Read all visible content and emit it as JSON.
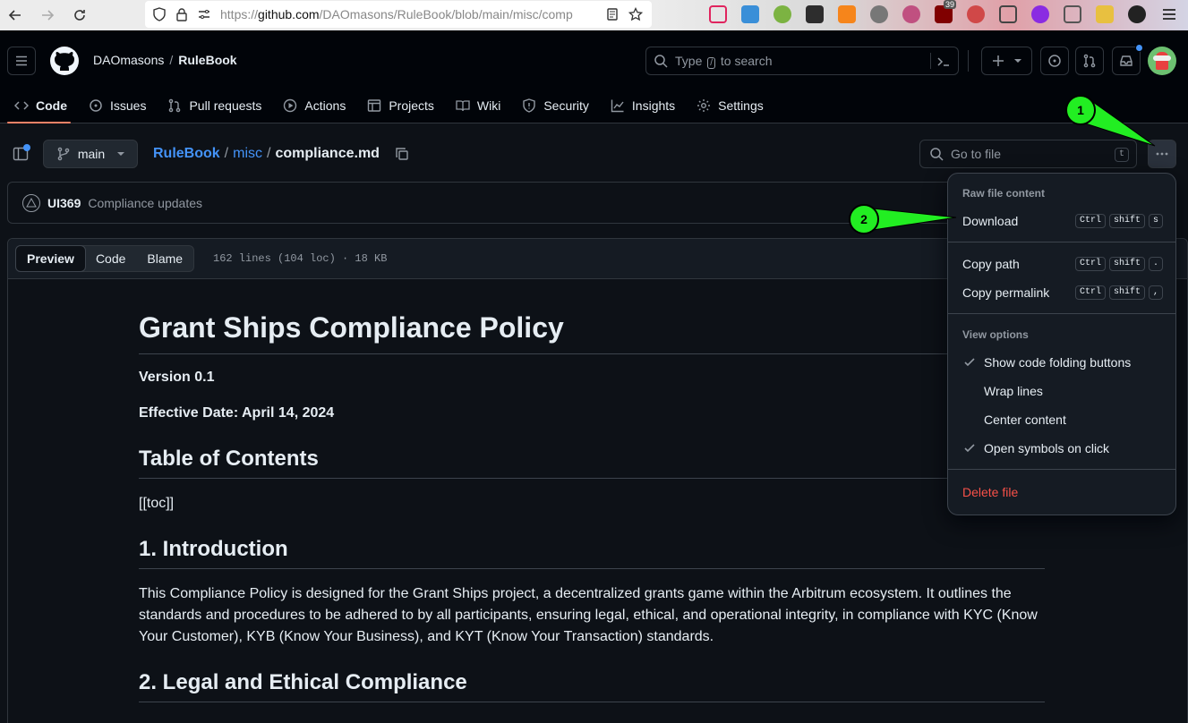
{
  "browser": {
    "url_domain": "github.com",
    "url_path": "/DAOmasons/RuleBook/blob/main/misc/comp",
    "url_prefix": "https://",
    "badge_count": "39"
  },
  "header": {
    "owner": "DAOmasons",
    "separator": "/",
    "repo": "RuleBook",
    "search_prefix": "Type",
    "search_key": "/",
    "search_suffix": "to search"
  },
  "tabs": [
    {
      "label": "Code"
    },
    {
      "label": "Issues"
    },
    {
      "label": "Pull requests"
    },
    {
      "label": "Actions"
    },
    {
      "label": "Projects"
    },
    {
      "label": "Wiki"
    },
    {
      "label": "Security"
    },
    {
      "label": "Insights"
    },
    {
      "label": "Settings"
    }
  ],
  "file_header": {
    "branch": "main",
    "path_repo": "RuleBook",
    "path_dir": "misc",
    "path_file": "compliance.md",
    "path_sep": "/",
    "go_to_file": "Go to file",
    "go_to_file_key": "t"
  },
  "commit": {
    "author": "UI369",
    "message": "Compliance updates"
  },
  "file_toolbar": {
    "preview": "Preview",
    "code": "Code",
    "blame": "Blame",
    "info": "162 lines (104 loc) · 18 KB"
  },
  "markdown": {
    "title": "Grant Ships Compliance Policy",
    "version": "Version 0.1",
    "effective_date": "Effective Date: April 14, 2024",
    "toc_heading": "Table of Contents",
    "toc": "[[toc]]",
    "h_intro": "1. Introduction",
    "intro_text": "This Compliance Policy is designed for the Grant Ships project, a decentralized grants game within the Arbitrum ecosystem. It outlines the standards and procedures to be adhered to by all participants, ensuring legal, ethical, and operational integrity, in compliance with KYC (Know Your Customer), KYB (Know Your Business), and KYT (Know Your Transaction) standards.",
    "h_legal": "2. Legal and Ethical Compliance"
  },
  "menu": {
    "raw_header": "Raw file content",
    "download": "Download",
    "download_keys": [
      "Ctrl",
      "shift",
      "s"
    ],
    "copy_path": "Copy path",
    "copy_path_keys": [
      "Ctrl",
      "shift",
      "."
    ],
    "copy_permalink": "Copy permalink",
    "copy_permalink_keys": [
      "Ctrl",
      "shift",
      ","
    ],
    "view_header": "View options",
    "show_folding": "Show code folding buttons",
    "wrap_lines": "Wrap lines",
    "center_content": "Center content",
    "open_symbols": "Open symbols on click",
    "delete_file": "Delete file"
  },
  "annotations": {
    "one": "1",
    "two": "2"
  },
  "colors": {
    "accent_link": "#4493f8",
    "tab_underline": "#f78166",
    "danger": "#f85149",
    "annotation": "#22ee22"
  }
}
